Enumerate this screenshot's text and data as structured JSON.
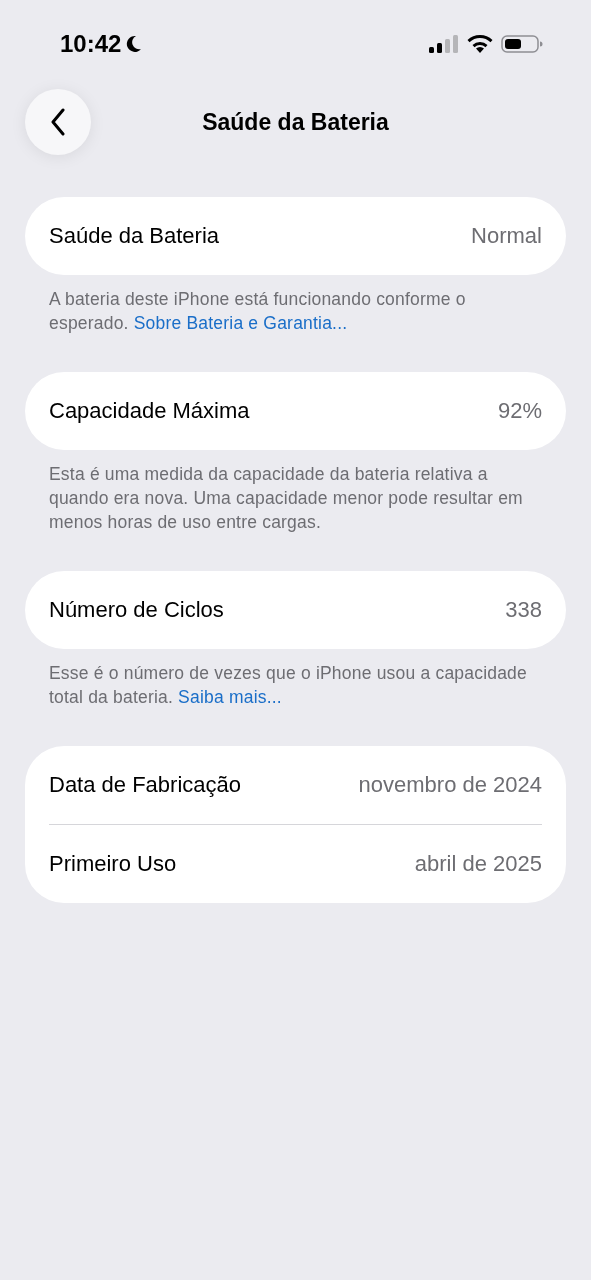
{
  "status_bar": {
    "time": "10:42"
  },
  "nav": {
    "title": "Saúde da Bateria"
  },
  "sections": [
    {
      "rows": [
        {
          "label": "Saúde da Bateria",
          "value": "Normal"
        }
      ],
      "footer": {
        "text": "A bateria deste iPhone está funcionando conforme o esperado.",
        "link": "Sobre Bateria e Garantia..."
      }
    },
    {
      "rows": [
        {
          "label": "Capacidade Máxima",
          "value": "92%"
        }
      ],
      "footer": {
        "text": "Esta é uma medida da capacidade da bateria relativa a quando era nova. Uma capacidade menor pode resultar em menos horas de uso entre cargas."
      }
    },
    {
      "rows": [
        {
          "label": "Número de Ciclos",
          "value": "338"
        }
      ],
      "footer": {
        "text": "Esse é o número de vezes que o iPhone usou a capacidade total da bateria.",
        "link": "Saiba mais..."
      }
    },
    {
      "rows": [
        {
          "label": "Data de Fabricação",
          "value": "novembro de 2024"
        },
        {
          "label": "Primeiro Uso",
          "value": "abril de 2025"
        }
      ]
    }
  ]
}
